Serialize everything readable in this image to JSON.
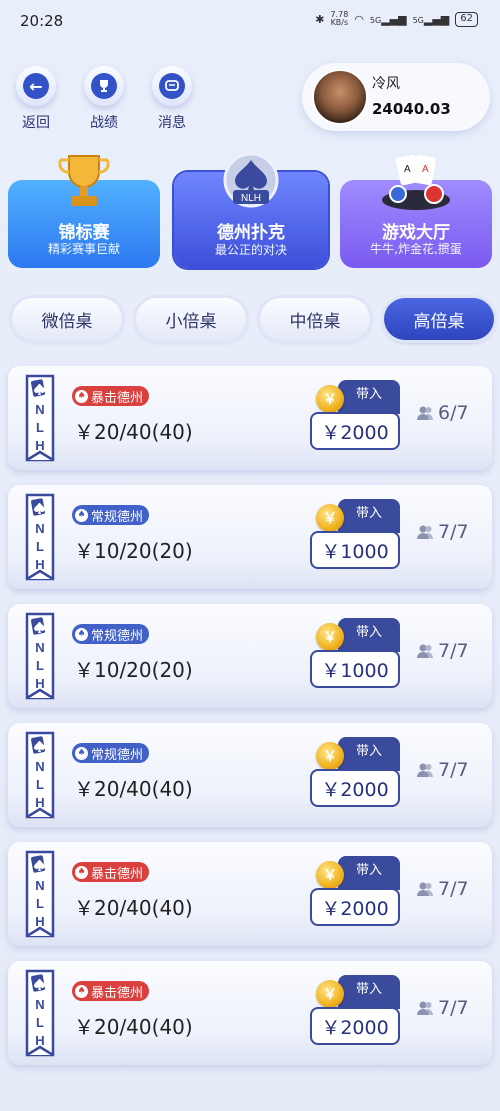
{
  "status_bar": {
    "time": "20:28",
    "net_speed_value": "7.78",
    "net_speed_unit": "KB/s",
    "signal_label_1": "5G",
    "signal_label_2": "5G",
    "battery": "62"
  },
  "top_nav": {
    "back": "返回",
    "records": "战绩",
    "messages": "消息"
  },
  "profile": {
    "name": "冷风",
    "balance": "24040.03"
  },
  "categories": [
    {
      "title": "锦标赛",
      "subtitle": "精彩赛事巨献"
    },
    {
      "title": "德州扑克",
      "subtitle": "最公正的对决",
      "badge": "NLH"
    },
    {
      "title": "游戏大厅",
      "subtitle": "牛牛,炸金花,掼蛋"
    }
  ],
  "table_tabs": [
    "微倍桌",
    "小倍桌",
    "中倍桌",
    "高倍桌"
  ],
  "active_tab": "高倍桌",
  "buyin_label": "带入",
  "banner_text": "NLH",
  "rooms": [
    {
      "type": "暴击德州",
      "style": "red",
      "stakes": "￥20/40(40)",
      "buyin": "￥2000",
      "players": "6/7"
    },
    {
      "type": "常规德州",
      "style": "blue",
      "stakes": "￥10/20(20)",
      "buyin": "￥1000",
      "players": "7/7"
    },
    {
      "type": "常规德州",
      "style": "blue",
      "stakes": "￥10/20(20)",
      "buyin": "￥1000",
      "players": "7/7"
    },
    {
      "type": "常规德州",
      "style": "blue",
      "stakes": "￥20/40(40)",
      "buyin": "￥2000",
      "players": "7/7"
    },
    {
      "type": "暴击德州",
      "style": "red",
      "stakes": "￥20/40(40)",
      "buyin": "￥2000",
      "players": "7/7"
    },
    {
      "type": "暴击德州",
      "style": "red",
      "stakes": "￥20/40(40)",
      "buyin": "￥2000",
      "players": "7/7"
    }
  ]
}
